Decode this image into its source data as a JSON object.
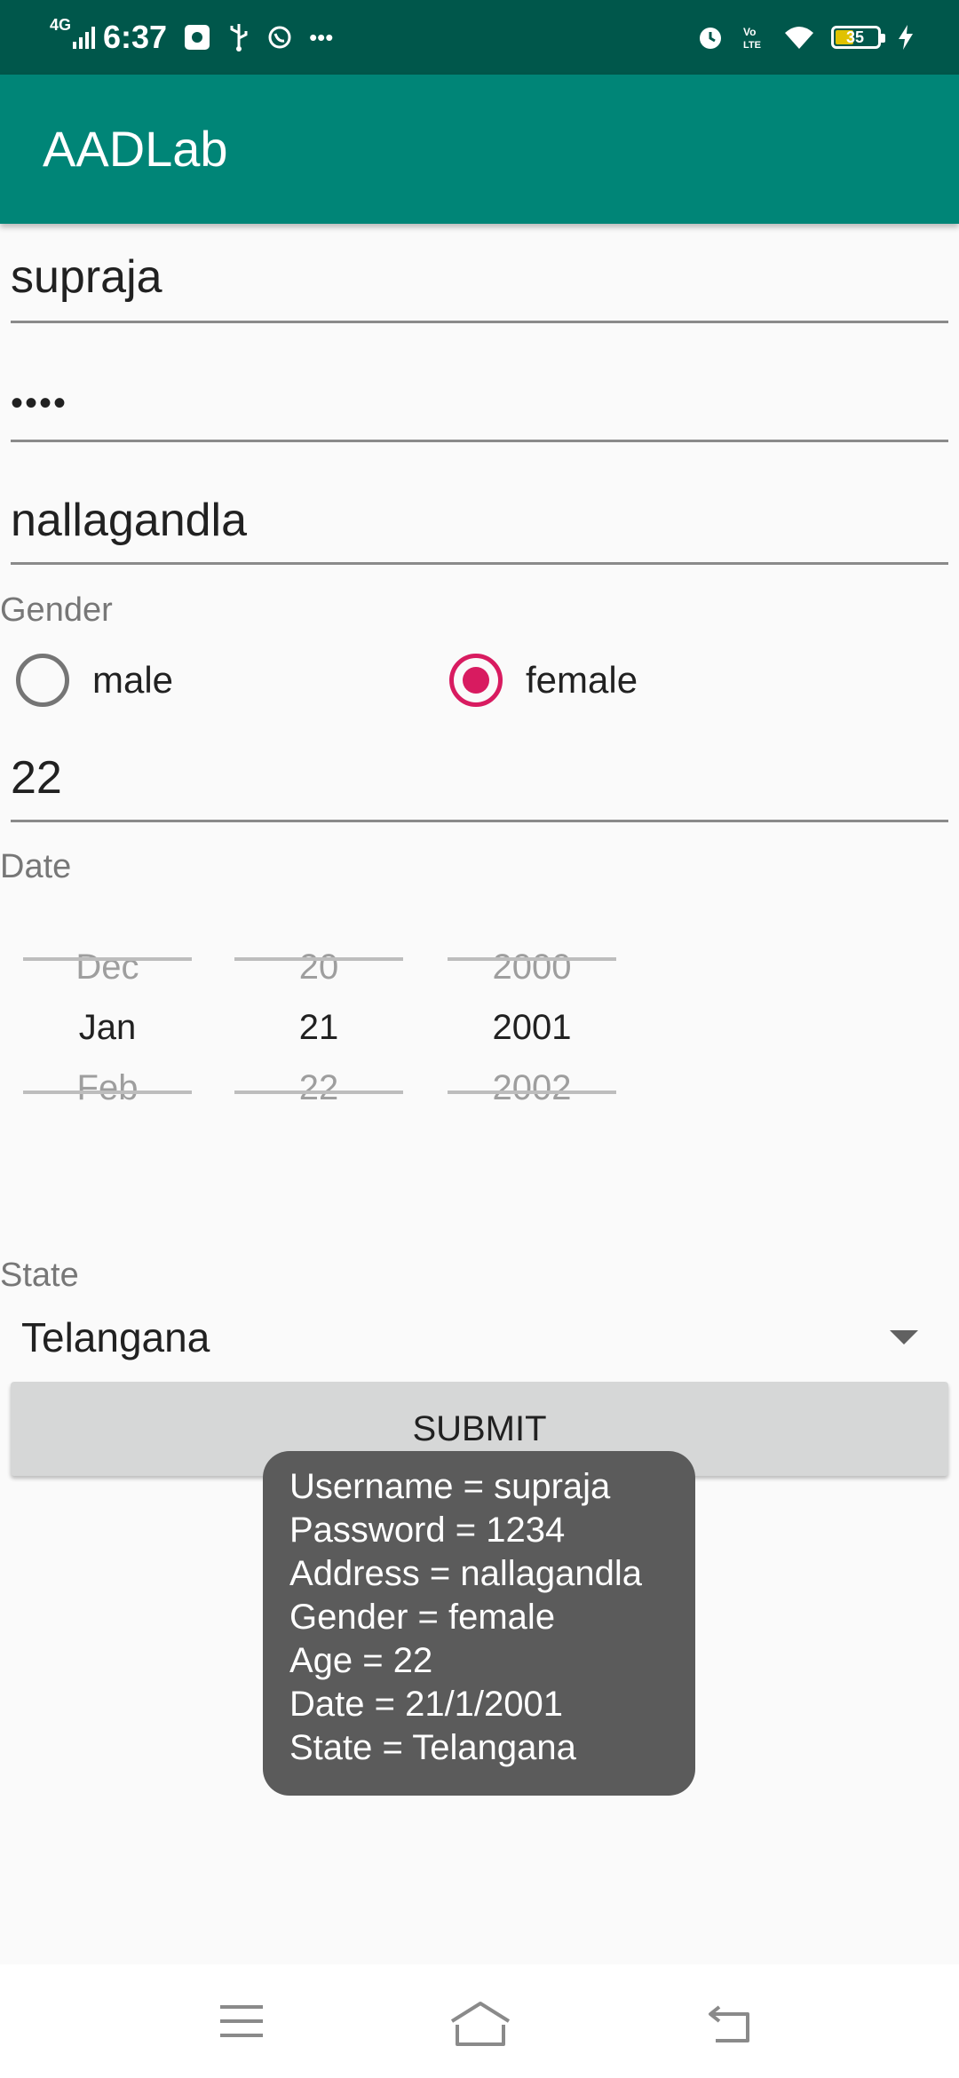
{
  "status_bar": {
    "network": "4G",
    "time": "6:37",
    "battery": "35"
  },
  "app_bar": {
    "title": "AADLab"
  },
  "form": {
    "username": "supraja",
    "password_masked": "••••",
    "address": "nallagandla",
    "gender_label": "Gender",
    "gender_options": [
      {
        "label": "male",
        "checked": false
      },
      {
        "label": "female",
        "checked": true
      }
    ],
    "age": "22",
    "date_label": "Date",
    "date_picker": {
      "month": {
        "prev": "Dec",
        "current": "Jan",
        "next": "Feb"
      },
      "day": {
        "prev": "20",
        "current": "21",
        "next": "22"
      },
      "year": {
        "prev": "2000",
        "current": "2001",
        "next": "2002"
      }
    },
    "state_label": "State",
    "state_value": "Telangana",
    "submit_label": "SUBMIT"
  },
  "toast": {
    "lines": [
      "Username = supraja",
      "Password = 1234",
      "Address = nallagandla",
      "Gender = female",
      "Age = 22",
      "Date = 21/1/2001",
      "State = Telangana"
    ]
  },
  "colors": {
    "status_bar": "#00574b",
    "app_bar": "#008577",
    "accent": "#d81b60"
  },
  "nav_bar": {
    "icons": [
      "menu-icon",
      "home-icon",
      "back-icon"
    ]
  }
}
